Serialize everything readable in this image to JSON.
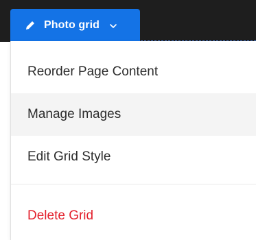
{
  "colors": {
    "topbar_bg": "#1e1e1e",
    "accent": "#1473e6",
    "hover_bg": "#f4f4f4",
    "danger": "#e3202c",
    "text": "#2c2c2c"
  },
  "block_selector": {
    "icon": "pencil-icon",
    "label": "Photo grid",
    "dropdown_icon": "chevron-down-icon"
  },
  "menu": {
    "items": [
      {
        "label": "Reorder Page Content"
      },
      {
        "label": "Manage Images",
        "state": "hovered"
      },
      {
        "label": "Edit Grid Style"
      }
    ],
    "danger_item": {
      "label": "Delete Grid"
    }
  }
}
